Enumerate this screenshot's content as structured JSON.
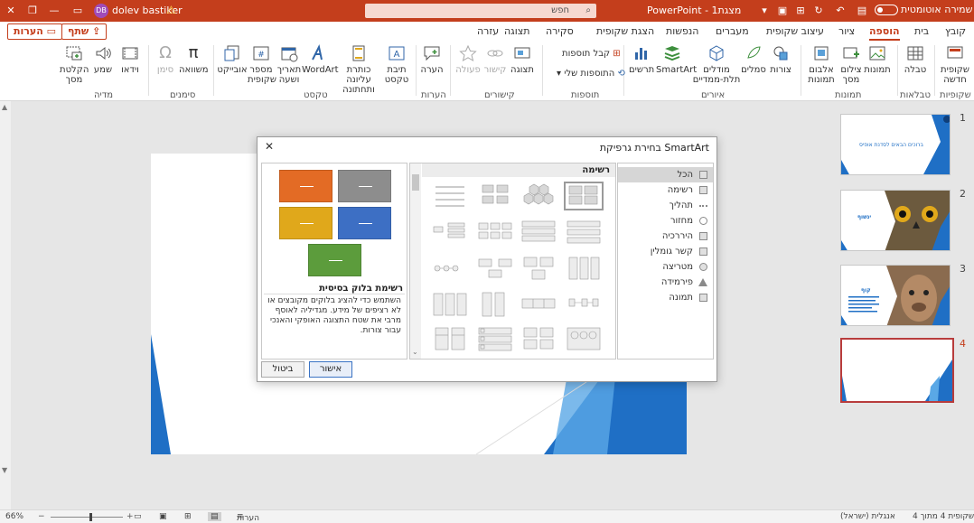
{
  "titlebar": {
    "autosave_label": "שמירה אוטומטית",
    "file_name": "מצגת1",
    "app_name": "PowerPoint",
    "title_separator": " - ",
    "search_placeholder": "חפש",
    "user_name": "dolev bastiker",
    "user_initials": "DB"
  },
  "tabs": [
    {
      "label": "קובץ"
    },
    {
      "label": "בית"
    },
    {
      "label": "הוספה",
      "active": true
    },
    {
      "label": "ציור"
    },
    {
      "label": "עיצוב שקופית"
    },
    {
      "label": "מעברים"
    },
    {
      "label": "הנפשות"
    },
    {
      "label": "הצגת שקופית"
    },
    {
      "label": "סקירה"
    },
    {
      "label": "תצוגה"
    },
    {
      "label": "עזרה"
    }
  ],
  "share_label": "שתף",
  "comments_label": "הערות",
  "ribbon": {
    "buttons": {
      "new_slide": "שקופית חדשה",
      "table": "טבלה",
      "images": "תמונות",
      "screenshot": "צילום מסך",
      "album": "אלבום תמונות",
      "shapes": "צורות",
      "icons": "סמלים",
      "models3d": "מודלים תלת-ממדיים",
      "smartart": "SmartArt",
      "chart": "תרשים",
      "get_addins": "קבל תוספות",
      "my_addins": "התוספות שלי",
      "zoom": "תצוגה",
      "link": "קישור",
      "action": "פעולה",
      "comment": "הערה",
      "textbox": "תיבת טקסט",
      "header_footer": "כותרת עליונה ותחתונה",
      "wordart": "WordArt",
      "date_time": "תאריך ושעה",
      "slide_number": "מספר שקופית",
      "object": "אובייקט",
      "equation": "משוואה",
      "symbol": "סימן",
      "video": "וידאו",
      "audio": "שמע",
      "screen_recording": "הקלטת מסך"
    },
    "groups": {
      "slides": "שקופיות",
      "tables": "טבלאות",
      "images": "תמונות",
      "illustrations": "איורים",
      "addins": "תוספות",
      "links": "קישורים",
      "comments": "הערות",
      "text": "טקסט",
      "symbols": "סימנים",
      "media": "מדיה"
    }
  },
  "thumbnails": {
    "slide1_title": "ברוכים הבאים לסדנת אופיס",
    "slide2_title": "ינשוף",
    "slide3_title": "קוף"
  },
  "dialog": {
    "title": "בחירת גרפיקת SmartArt",
    "gallery_header": "רשימה",
    "categories": [
      {
        "label": "הכל",
        "selected": true
      },
      {
        "label": "רשימה"
      },
      {
        "label": "תהליך"
      },
      {
        "label": "מחזור"
      },
      {
        "label": "היררכיה"
      },
      {
        "label": "קשר גומלין"
      },
      {
        "label": "מטריצה"
      },
      {
        "label": "פירמידה"
      },
      {
        "label": "תמונה"
      }
    ],
    "preview_title": "רשימת בלוק בסיסית",
    "preview_description": "השתמש כדי להציג בלוקים מקובצים או לא רציפים של מידע. מגדיליה לאוסף מרבי את שטח התצוגה האופקי והאנכי עבור צורות.",
    "preview_colors": [
      "#e36b25",
      "#8d8d8d",
      "#e0a81b",
      "#3d6fc4",
      "#5c9c3c"
    ],
    "ok_label": "אישור",
    "cancel_label": "ביטול"
  },
  "statusbar": {
    "slide_info": "שקופית 4 מתוך 4",
    "language": "אנגלית (ישראל)",
    "notes_label": "הערות",
    "zoom_level": "66%"
  },
  "colors": {
    "accent": "#c43e1c",
    "slide_blue": "#1f6fc5"
  }
}
